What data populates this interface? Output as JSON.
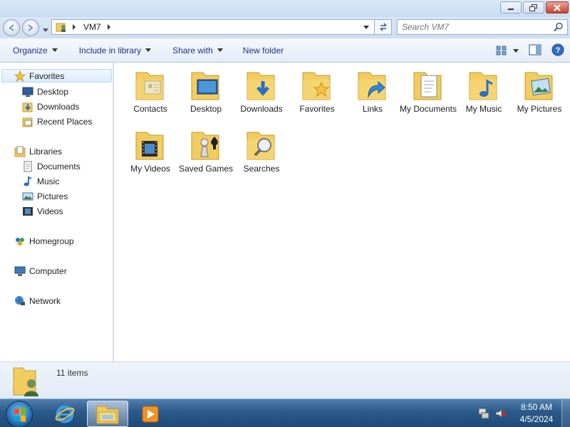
{
  "window": {
    "title": ""
  },
  "address": {
    "path": [
      "VM7"
    ],
    "search_placeholder": "Search VM7"
  },
  "commands": {
    "organize": "Organize",
    "include_in_library": "Include in library",
    "share_with": "Share with",
    "new_folder": "New folder"
  },
  "nav": {
    "favorites": "Favorites",
    "desktop": "Desktop",
    "downloads": "Downloads",
    "recent_places": "Recent Places",
    "libraries": "Libraries",
    "documents": "Documents",
    "music": "Music",
    "pictures": "Pictures",
    "videos": "Videos",
    "homegroup": "Homegroup",
    "computer": "Computer",
    "network": "Network"
  },
  "items": [
    {
      "label": "Contacts",
      "icon": "contacts-folder-icon"
    },
    {
      "label": "Desktop",
      "icon": "desktop-folder-icon"
    },
    {
      "label": "Downloads",
      "icon": "downloads-folder-icon"
    },
    {
      "label": "Favorites",
      "icon": "favorites-folder-icon"
    },
    {
      "label": "Links",
      "icon": "links-folder-icon"
    },
    {
      "label": "My Documents",
      "icon": "documents-folder-icon"
    },
    {
      "label": "My Music",
      "icon": "music-folder-icon"
    },
    {
      "label": "My Pictures",
      "icon": "pictures-folder-icon"
    },
    {
      "label": "My Videos",
      "icon": "videos-folder-icon"
    },
    {
      "label": "Saved Games",
      "icon": "saved-games-folder-icon"
    },
    {
      "label": "Searches",
      "icon": "searches-folder-icon"
    }
  ],
  "status": {
    "count": "11 items"
  },
  "taskbar": {
    "time": "8:50 AM",
    "date": "4/5/2024"
  },
  "colors": {
    "folder": "#f2cc5f",
    "link_text": "#1e3287",
    "taskbar": "#2b5a8a",
    "selection": "#dcebfc"
  }
}
